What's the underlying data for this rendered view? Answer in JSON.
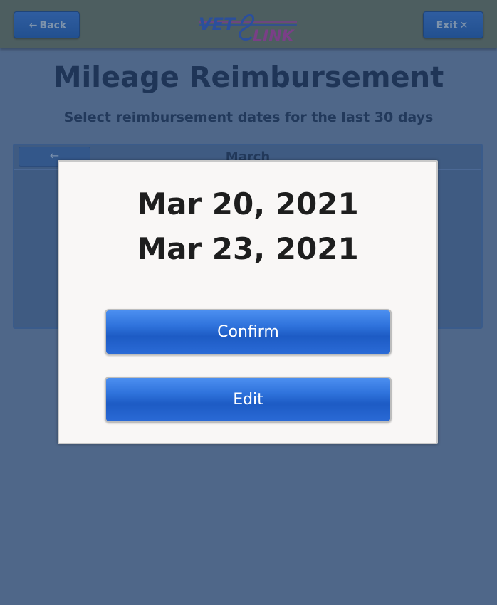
{
  "header": {
    "back_label": "Back",
    "back_glyph": "←",
    "exit_label": "Exit",
    "exit_glyph": "✕",
    "logo_left": "VET",
    "logo_right": "LINK"
  },
  "page": {
    "title": "Mileage Reimbursement",
    "subtitle": "Select reimbursement dates for the last 30 days"
  },
  "calendar": {
    "prev_glyph": "←",
    "month": "March"
  },
  "modal": {
    "dates": [
      "Mar 20, 2021",
      "Mar 23, 2021"
    ],
    "confirm_label": "Confirm",
    "edit_label": "Edit"
  },
  "colors": {
    "overlay_background": "#4f6789",
    "button_blue": "#2f73dc",
    "modal_background": "#f9f7f6"
  },
  "icons": {
    "back": "arrow-left-icon",
    "exit": "close-icon",
    "calendar_prev": "arrow-left-icon"
  }
}
